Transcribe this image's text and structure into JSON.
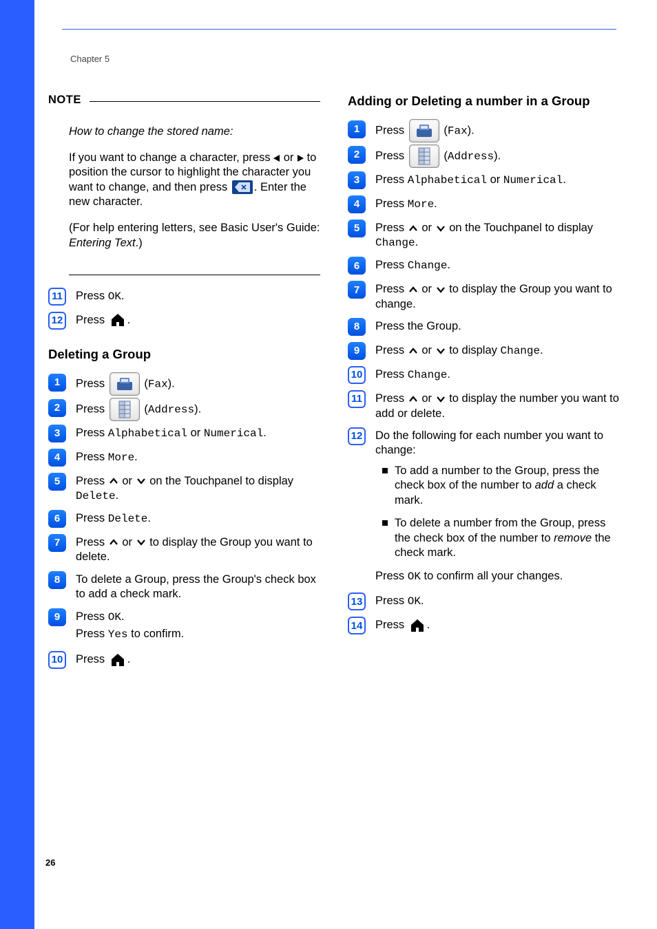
{
  "chapter": "Chapter 5",
  "page_number": "26",
  "note": {
    "title": "NOTE",
    "intro": "How to change the stored name:",
    "body1_a": "If you want to change a character, press ",
    "body1_b": " or ",
    "body1_c": " to position the cursor to highlight the character you want to change, and then press ",
    "body1_d": ". Enter the new character.",
    "body2_a": "(For help entering letters, see Basic User's Guide: ",
    "body2_b": "Entering Text",
    "body2_c": ".)"
  },
  "cont_steps": {
    "s11_a": "Press ",
    "s11_b": "OK",
    "s11_c": ".",
    "s12_a": "Press ",
    "s12_b": "."
  },
  "deleting": {
    "heading": "Deleting a Group",
    "s1_a": "Press ",
    "s1_b": " (",
    "s1_c": "Fax",
    "s1_d": ").",
    "s2_a": "Press ",
    "s2_b": " (",
    "s2_c": "Address",
    "s2_d": ").",
    "s3_a": "Press ",
    "s3_b": "Alphabetical",
    "s3_c": " or ",
    "s3_d": "Numerical",
    "s3_e": ".",
    "s4_a": "Press ",
    "s4_b": "More",
    "s4_c": ".",
    "s5_a": "Press ",
    "s5_b": " or ",
    "s5_c": " on the Touchpanel to display ",
    "s5_d": "Delete",
    "s5_e": ".",
    "s6_a": "Press ",
    "s6_b": "Delete",
    "s6_c": ".",
    "s7_a": "Press ",
    "s7_b": " or ",
    "s7_c": " to display the Group you want to delete.",
    "s8": "To delete a Group, press the Group's check box to add a check mark.",
    "s9_a": "Press ",
    "s9_b": "OK",
    "s9_c": ".",
    "s9_d": "Press ",
    "s9_e": "Yes",
    "s9_f": " to confirm.",
    "s10_a": "Press ",
    "s10_b": "."
  },
  "adding": {
    "heading": "Adding or Deleting a number in a Group",
    "s1_a": "Press ",
    "s1_b": " (",
    "s1_c": "Fax",
    "s1_d": ").",
    "s2_a": "Press ",
    "s2_b": " (",
    "s2_c": "Address",
    "s2_d": ").",
    "s3_a": "Press ",
    "s3_b": "Alphabetical",
    "s3_c": " or ",
    "s3_d": "Numerical",
    "s3_e": ".",
    "s4_a": "Press ",
    "s4_b": "More",
    "s4_c": ".",
    "s5_a": "Press ",
    "s5_b": " or ",
    "s5_c": " on the Touchpanel to display ",
    "s5_d": "Change",
    "s5_e": ".",
    "s6_a": "Press ",
    "s6_b": "Change",
    "s6_c": ".",
    "s7_a": "Press ",
    "s7_b": " or ",
    "s7_c": " to display the Group you want to change.",
    "s8": "Press the Group.",
    "s9_a": "Press ",
    "s9_b": " or ",
    "s9_c": " to display ",
    "s9_d": "Change",
    "s9_e": ".",
    "s10_a": "Press ",
    "s10_b": "Change",
    "s10_c": ".",
    "s11_a": "Press ",
    "s11_b": " or ",
    "s11_c": " to display the number you want to add or delete.",
    "s12_intro": "Do the following for each number you want to change:",
    "s12_b1_a": "To add a number to the Group, press the check box of the number to ",
    "s12_b1_b": "add",
    "s12_b1_c": " a check mark.",
    "s12_b2_a": "To delete a number from the Group, press the check box of the number to ",
    "s12_b2_b": "remove",
    "s12_b2_c": " the check mark.",
    "s12_conf_a": "Press ",
    "s12_conf_b": "OK",
    "s12_conf_c": " to confirm all your changes.",
    "s13_a": "Press ",
    "s13_b": "OK",
    "s13_c": ".",
    "s14_a": "Press ",
    "s14_b": "."
  }
}
